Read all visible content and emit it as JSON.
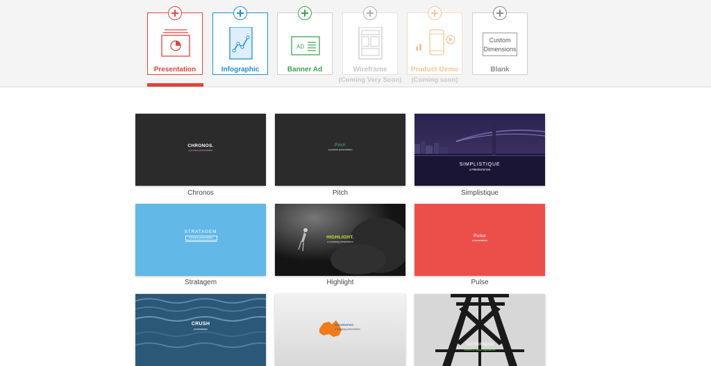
{
  "types": [
    {
      "label": "Presentation",
      "sub": "",
      "color": "#e0433b"
    },
    {
      "label": "Infographic",
      "sub": "",
      "color": "#1b8fd6"
    },
    {
      "label": "Banner Ad",
      "sub": "",
      "color": "#3aa34a"
    },
    {
      "label": "Wireframe",
      "sub": "(Coming Very Soon)",
      "color": "#c8c8c8"
    },
    {
      "label": "Product Demo",
      "sub": "(Coming soon)",
      "color": "#f7c596"
    },
    {
      "label": "Blank",
      "sub": "",
      "color": "#8a8a8a"
    }
  ],
  "custom_box": {
    "line1": "Custom",
    "line2": "Dimensions"
  },
  "banner_icon_text": "AD",
  "templates": [
    {
      "name": "Chronos",
      "title": "CHRONOS.",
      "subtitle": "a product presentation",
      "bg": "#2b2b2b"
    },
    {
      "name": "Pitch",
      "title": "Pitch",
      "subtitle": "a product presentation",
      "bg": "#2b2b2b"
    },
    {
      "name": "Simplistique",
      "title": "SIMPLISTIQUE",
      "subtitle": "A PRESENTATION",
      "bg": "#1c1a38"
    },
    {
      "name": "Stratagem",
      "title": "STRATAGEM",
      "subtitle": "a product presentation",
      "bg": "#62b8e6"
    },
    {
      "name": "Highlight",
      "title": "HIGHLIGHT.",
      "subtitle": "a company presentation",
      "bg": "#151515"
    },
    {
      "name": "Pulse",
      "title": "Pulse",
      "subtitle": "a presentation",
      "bg": "#ec4f4a"
    },
    {
      "name": "",
      "title": "CRUSH",
      "subtitle": "presentation",
      "bg": "#2a5573"
    },
    {
      "name": "",
      "title": "GEOGRAPHIC",
      "subtitle": "a mapping presentation",
      "bg": "#e8e8e8"
    },
    {
      "name": "",
      "title": "Technological",
      "subtitle": "Modern & Tablet Applications",
      "bg": "#d6d6d6"
    }
  ]
}
